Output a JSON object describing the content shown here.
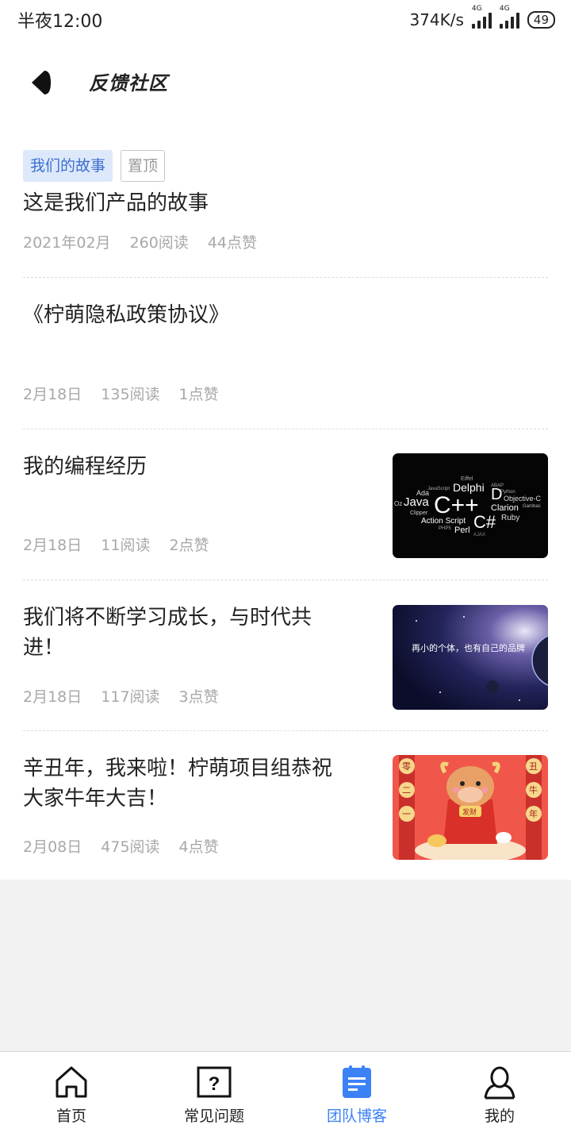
{
  "status_bar": {
    "time": "半夜12:00",
    "speed": "374K/s",
    "network1": "4G",
    "network2": "4G",
    "battery": "49"
  },
  "header": {
    "title": "反馈社区"
  },
  "posts": [
    {
      "tags": [
        "我们的故事",
        "置顶"
      ],
      "title": "这是我们产品的故事",
      "date": "2021年02月",
      "reads": "260阅读",
      "likes": "44点赞"
    },
    {
      "title": "《柠萌隐私政策协议》",
      "date": "2月18日",
      "reads": "135阅读",
      "likes": "1点赞"
    },
    {
      "title": "我的编程经历",
      "date": "2月18日",
      "reads": "11阅读",
      "likes": "2点赞",
      "thumb_words": [
        "Delphi",
        "D",
        "C++",
        "C#",
        "Java",
        "Ada",
        "Clarion",
        "Ruby",
        "Perl",
        "Action Script",
        "Objective-C",
        "Clipper",
        "Eiffel",
        "ABAP",
        "Python",
        "PHP5",
        "AJAX",
        "Oz",
        "JavaScript",
        "Gambas"
      ]
    },
    {
      "title": "我们将不断学习成长，与时代共进！",
      "date": "2月18日",
      "reads": "117阅读",
      "likes": "3点赞",
      "thumb_text": "再小的个体，也有自己的品牌"
    },
    {
      "title": "辛丑年，我来啦！柠萌项目组恭祝大家牛年大吉！",
      "date": "2月08日",
      "reads": "475阅读",
      "likes": "4点赞",
      "thumb_left": [
        "零",
        "二",
        "一"
      ],
      "thumb_right": [
        "丑",
        "牛",
        "年"
      ],
      "thumb_badge": "发财"
    }
  ],
  "tabbar": [
    {
      "label": "首页",
      "icon": "home-icon"
    },
    {
      "label": "常见问题",
      "icon": "question-icon"
    },
    {
      "label": "团队博客",
      "icon": "blog-icon",
      "active": true
    },
    {
      "label": "我的",
      "icon": "user-icon"
    }
  ],
  "colors": {
    "accent": "#3b82f6",
    "tag_bg": "#dde9fb",
    "tag_text": "#3c6fd1",
    "meta": "#a8a8a8"
  }
}
